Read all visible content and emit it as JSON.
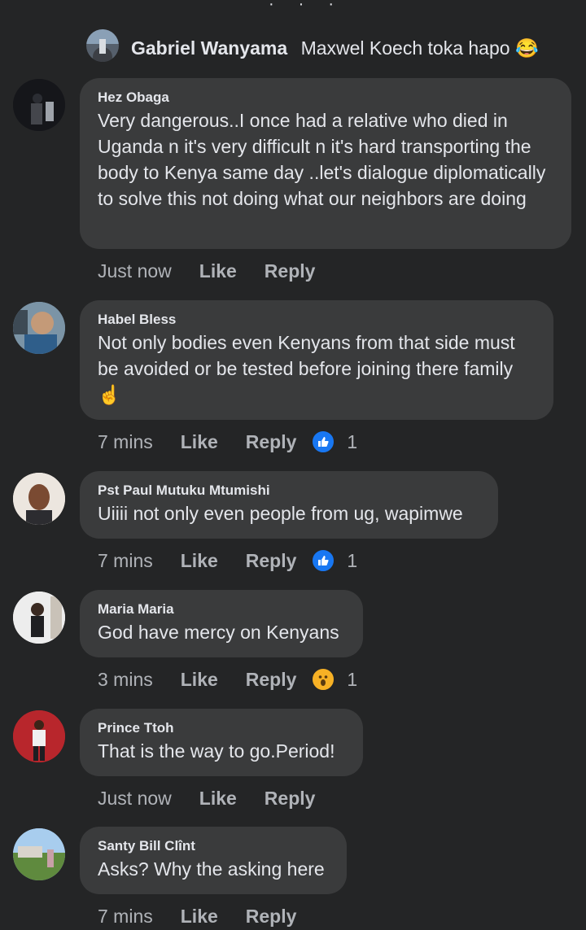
{
  "top_reply": {
    "author": "Gabriel Wanyama",
    "text": "Maxwel Koech toka hapo",
    "emoji": "😂"
  },
  "comments": [
    {
      "author": "Hez Obaga",
      "text": "Very dangerous..I once had a relative who died in Uganda n it's very difficult n it's hard transporting the body to Kenya same day ..let's dialogue diplomatically to solve this not doing what our neighbors are doing",
      "time": "Just now",
      "like_label": "Like",
      "reply_label": "Reply"
    },
    {
      "author": "Habel Bless",
      "text": "Not only bodies even Kenyans from that side must be avoided or be tested before joining there family",
      "emoji": "☝",
      "time": "7 mins",
      "like_label": "Like",
      "reply_label": "Reply",
      "reaction_icon": "like-reaction",
      "reaction_count": "1"
    },
    {
      "author": "Pst Paul Mutuku Mtumishi",
      "text": "Uiiii not only even people from ug, wapimwe",
      "time": "7 mins",
      "like_label": "Like",
      "reply_label": "Reply",
      "reaction_icon": "like-reaction",
      "reaction_count": "1"
    },
    {
      "author": "Maria Maria",
      "text": "God have mercy on Kenyans",
      "time": "3 mins",
      "like_label": "Like",
      "reply_label": "Reply",
      "reaction_icon": "wow-reaction",
      "reaction_count": "1"
    },
    {
      "author": "Prince Ttoh",
      "text": "That is the way to go.Period!",
      "time": "Just now",
      "like_label": "Like",
      "reply_label": "Reply"
    },
    {
      "author": "Santy Bill Clînt",
      "text": "Asks? Why the asking here",
      "time": "7 mins",
      "like_label": "Like",
      "reply_label": "Reply"
    }
  ],
  "colors": {
    "background": "#242526",
    "bubble": "#3a3b3c",
    "like_reaction": "#1877f2",
    "wow_reaction": "#f7b125"
  }
}
